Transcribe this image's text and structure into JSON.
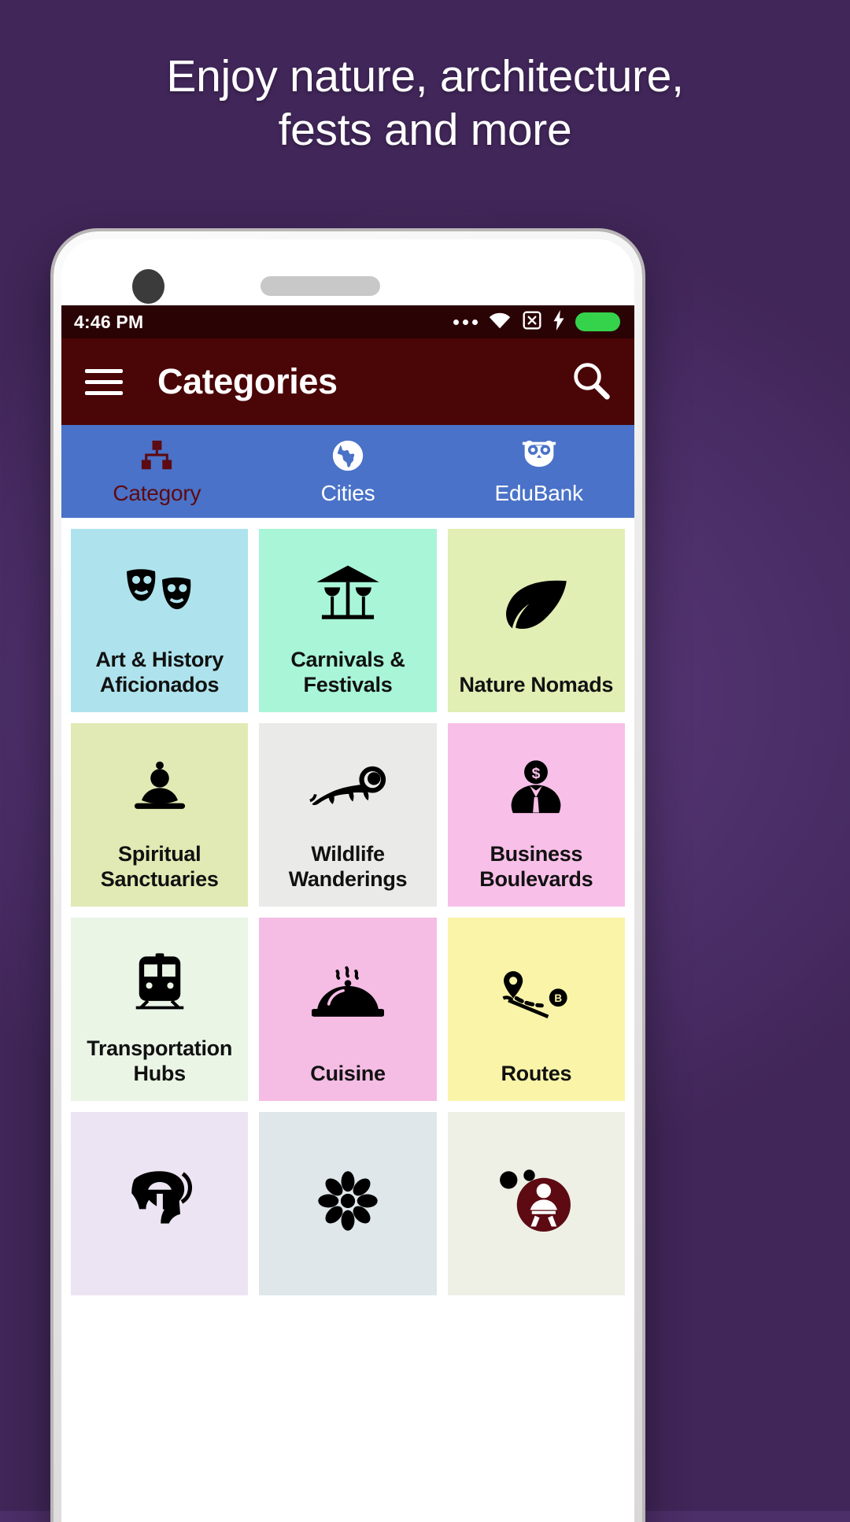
{
  "promo": {
    "headline_line1": "Enjoy nature, architecture,",
    "headline_line2": "fests and more",
    "background_color": "#4c2e68"
  },
  "status_bar": {
    "time": "4:46 PM",
    "background_color": "#2a0305",
    "icons": [
      "more-dots-icon",
      "wifi-icon",
      "no-sim-icon",
      "charging-bolt-icon",
      "battery-icon"
    ],
    "battery_color": "#35d24b"
  },
  "app_bar": {
    "menu_icon": "hamburger-menu-icon",
    "title": "Categories",
    "search_icon": "search-icon",
    "background_color": "#4a0507"
  },
  "tab_bar": {
    "background_color": "#4a72c8",
    "active_color": "#5d0a12",
    "tabs": [
      {
        "label": "Category",
        "icon": "sitemap-icon",
        "active": true
      },
      {
        "label": "Cities",
        "icon": "globe-icon",
        "active": false
      },
      {
        "label": "EduBank",
        "icon": "owl-icon",
        "active": false
      }
    ]
  },
  "grid": {
    "tiles": [
      {
        "label": "Art & History Aficionados",
        "icon": "theater-masks-icon",
        "color": "#aee3ed"
      },
      {
        "label": "Carnivals & Festivals",
        "icon": "carousel-icon",
        "color": "#a9f5d8"
      },
      {
        "label": "Nature Nomads",
        "icon": "leaf-icon",
        "color": "#e1eeb4"
      },
      {
        "label": "Spiritual Sanctuaries",
        "icon": "buddha-icon",
        "color": "#e1eab4"
      },
      {
        "label": "Wildlife Wanderings",
        "icon": "lion-icon",
        "color": "#eaeae8"
      },
      {
        "label": "Business Boulevards",
        "icon": "businessman-icon",
        "color": "#f8bfe8"
      },
      {
        "label": "Transportation Hubs",
        "icon": "train-icon",
        "color": "#eaf5e6"
      },
      {
        "label": "Cuisine",
        "icon": "food-cloche-icon",
        "color": "#f5bde4"
      },
      {
        "label": "Routes",
        "icon": "route-map-icon",
        "color": "#f9f4a8"
      },
      {
        "label": "",
        "icon": "spartan-helmet-icon",
        "color": "#ece4f2"
      },
      {
        "label": "",
        "icon": "flower-icon",
        "color": "#dfe7ea"
      },
      {
        "label": "",
        "icon": "people-circle-icon",
        "color": "#eef0e6"
      }
    ]
  }
}
